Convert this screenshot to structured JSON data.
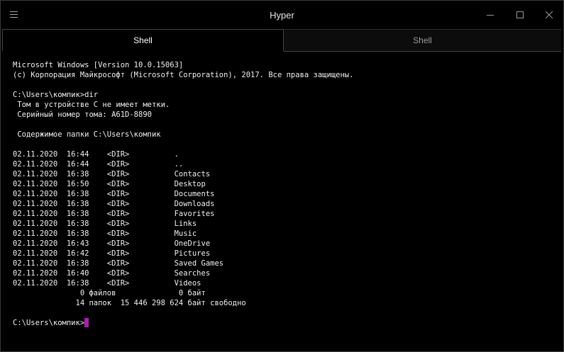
{
  "window": {
    "title": "Hyper",
    "menu_icon": "hamburger-menu-icon",
    "controls": [
      "minimize-icon",
      "maximize-icon",
      "close-icon"
    ]
  },
  "tabs": [
    {
      "label": "Shell",
      "active": true
    },
    {
      "label": "Shell",
      "active": false
    }
  ],
  "terminal": {
    "lines": [
      "Microsoft Windows [Version 10.0.15063]",
      "(c) Корпорация Майкрософт (Microsoft Corporation), 2017. Все права защищены.",
      "",
      "C:\\Users\\компик>dir",
      " Том в устройстве C не имеет метки.",
      " Серийный номер тома: A61D-8890",
      "",
      " Содержимое папки C:\\Users\\компик",
      "",
      "02.11.2020  16:44    <DIR>          .",
      "02.11.2020  16:44    <DIR>          ..",
      "02.11.2020  16:38    <DIR>          Contacts",
      "02.11.2020  16:50    <DIR>          Desktop",
      "02.11.2020  16:38    <DIR>          Documents",
      "02.11.2020  16:38    <DIR>          Downloads",
      "02.11.2020  16:38    <DIR>          Favorites",
      "02.11.2020  16:38    <DIR>          Links",
      "02.11.2020  16:38    <DIR>          Music",
      "02.11.2020  16:43    <DIR>          OneDrive",
      "02.11.2020  16:42    <DIR>          Pictures",
      "02.11.2020  16:38    <DIR>          Saved Games",
      "02.11.2020  16:40    <DIR>          Searches",
      "02.11.2020  16:38    <DIR>          Videos",
      "               0 файлов              0 байт",
      "              14 папок  15 446 298 624 байт свободно",
      ""
    ],
    "prompt": "C:\\Users\\компик>",
    "cursor_color": "#b01ab0"
  }
}
